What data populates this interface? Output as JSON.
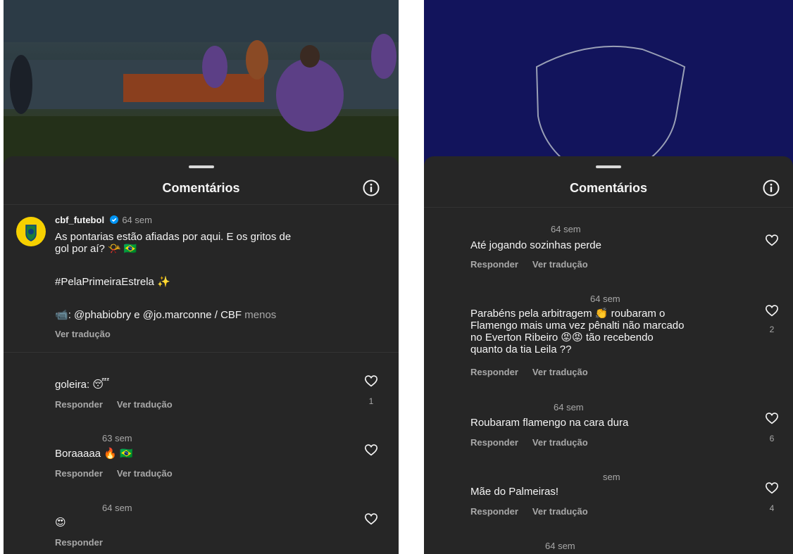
{
  "left": {
    "header_title": "Comentários",
    "caption": {
      "username": "cbf_futebol",
      "time": "64 sem",
      "text_line1": "As pontarias estão afiadas por aqui. E os gritos de",
      "text_line2": "gol por aí? 📯 🇧🇷",
      "hashtag": "#PelaPrimeiraEstrela ✨",
      "credits_icon": "📹",
      "credits": ": @phabiobry e @jo.marconne / CBF",
      "less_label": "menos",
      "translate_label": "Ver tradução"
    },
    "comments": [
      {
        "time": "",
        "text": "goleira: 😴",
        "reply": "Responder",
        "translate": "Ver tradução",
        "likes": "1"
      },
      {
        "time": "63 sem",
        "text": "Boraaaaa 🔥 🇧🇷",
        "reply": "Responder",
        "translate": "Ver tradução",
        "likes": ""
      },
      {
        "time": "64 sem",
        "text": "😍",
        "reply": "Responder",
        "likes": ""
      }
    ]
  },
  "right": {
    "header_title": "Comentários",
    "comments": [
      {
        "time": "64 sem",
        "lines": [
          "Até jogando sozinhas perde"
        ],
        "reply": "Responder",
        "translate": "Ver tradução",
        "likes": ""
      },
      {
        "time": "64 sem",
        "lines": [
          "Parabéns pela arbitragem 👏 roubaram o",
          "Flamengo mais uma vez pênalti não marcado",
          "no Everton Ribeiro 😡😡 tão recebendo",
          "quanto da tia Leila ??"
        ],
        "reply": "Responder",
        "translate": "Ver tradução",
        "likes": "2"
      },
      {
        "time": "64 sem",
        "lines": [
          "Roubaram flamengo na cara dura"
        ],
        "reply": "Responder",
        "translate": "Ver tradução",
        "likes": "6"
      },
      {
        "time": "sem",
        "lines": [
          "Mãe do Palmeiras!"
        ],
        "reply": "Responder",
        "translate": "Ver tradução",
        "likes": "4"
      },
      {
        "time": "64 sem",
        "lines": [],
        "reply": "",
        "translate": "",
        "likes": ""
      }
    ]
  },
  "icons": [
    "info-icon",
    "heart-icon",
    "verified-badge-icon",
    "cbf-crest-icon"
  ],
  "colors": {
    "sheet_bg": "#262626",
    "text": "#f5f5f5",
    "muted": "#a8a8a8",
    "verified": "#0095f6",
    "navy_bg": "#12145c",
    "avatar_yellow": "#f6d000"
  }
}
